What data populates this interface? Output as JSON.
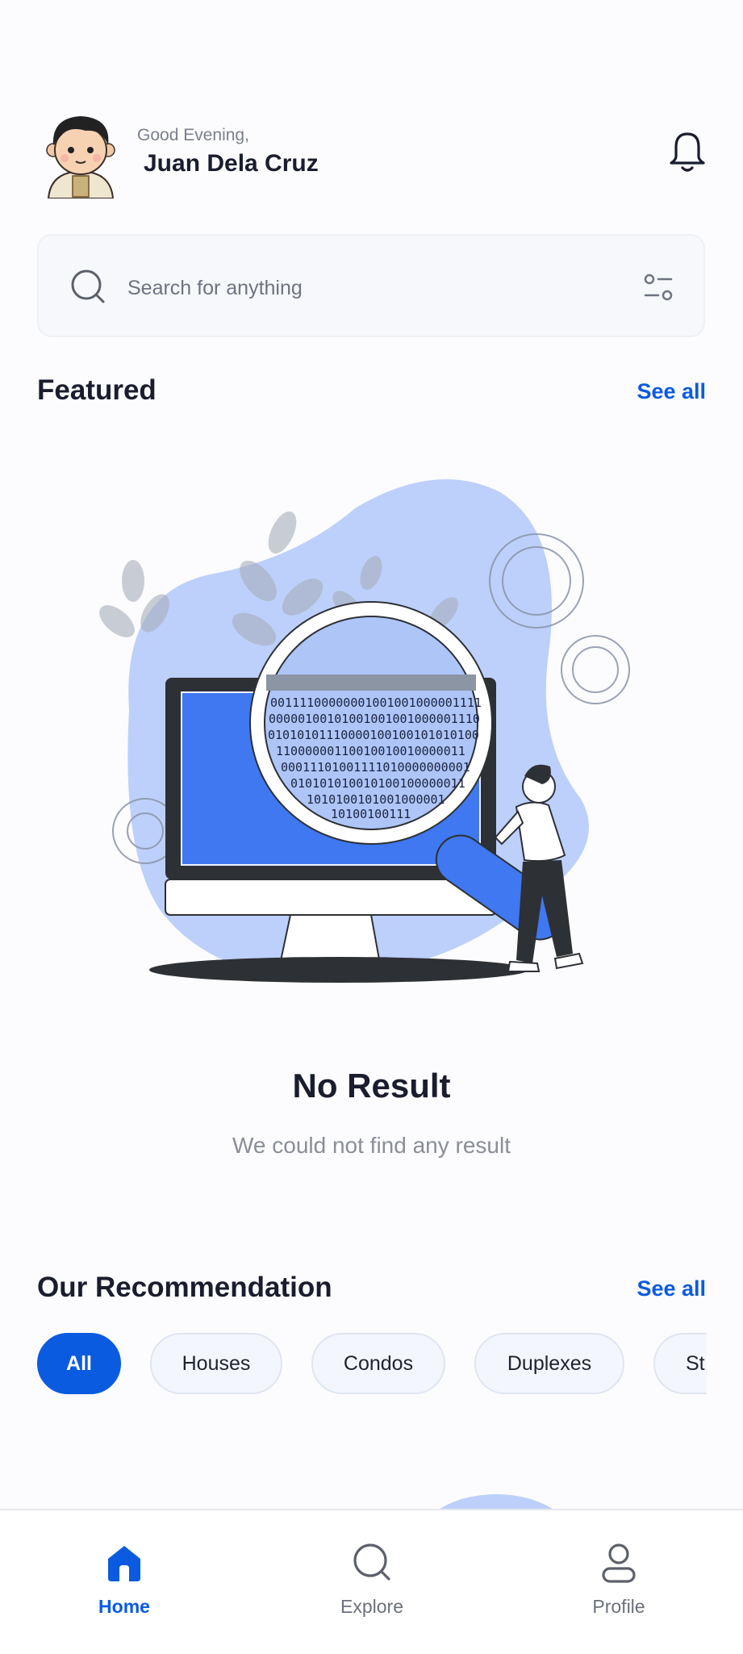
{
  "header": {
    "greeting": "Good Evening,",
    "user_name": "Juan Dela Cruz"
  },
  "search": {
    "placeholder": "Search for anything"
  },
  "featured": {
    "title": "Featured",
    "see_all": "See all",
    "empty_title": "No Result",
    "empty_subtitle": "We could not find any result",
    "screen_binary": [
      "00111100000001001001000001111",
      "00000100101001001001000001110",
      "01010101110000100100101010100",
      "11000000110010010010000011",
      "00011101001111010000000001",
      "010101010010100100000011",
      "1010100101001000001",
      "10100100111"
    ]
  },
  "recommendation": {
    "title": "Our Recommendation",
    "see_all": "See all",
    "filters": [
      "All",
      "Houses",
      "Condos",
      "Duplexes",
      "St"
    ],
    "active_filter": "All"
  },
  "bottom_nav": {
    "items": [
      {
        "label": "Home",
        "icon": "home-icon",
        "active": true
      },
      {
        "label": "Explore",
        "icon": "search-icon",
        "active": false
      },
      {
        "label": "Profile",
        "icon": "profile-icon",
        "active": false
      }
    ]
  },
  "colors": {
    "accent": "#0a5be0",
    "text_primary": "#1a1d2e",
    "text_muted": "#8a8e98",
    "illustration_blob": "#bdd0fb",
    "illustration_screen": "#3f78f0"
  }
}
